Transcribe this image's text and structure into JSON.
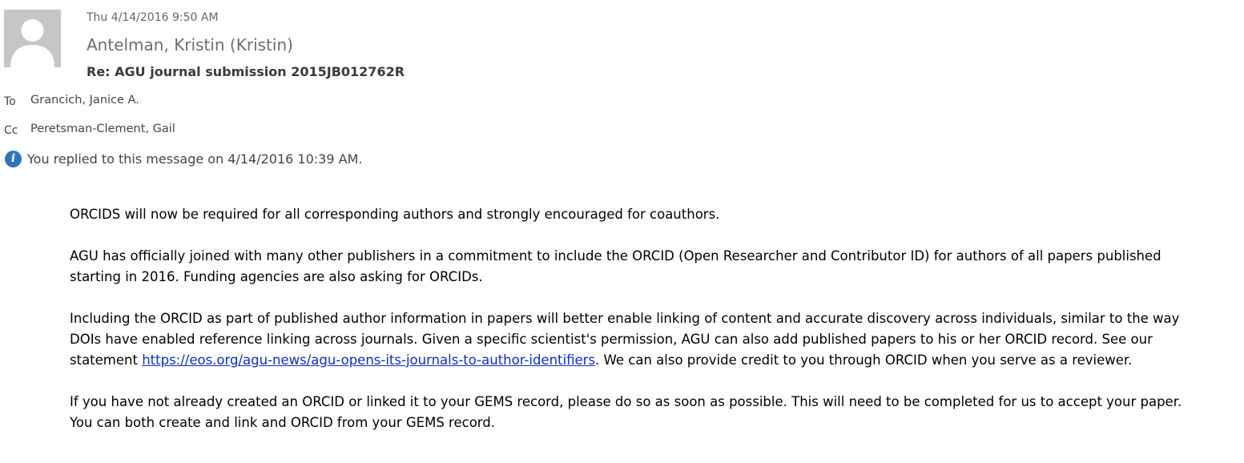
{
  "message": {
    "date": "Thu 4/14/2016 9:50 AM",
    "sender": "Antelman, Kristin (Kristin)",
    "subject": "Re: AGU journal submission 2015JB012762R",
    "to_label": "To",
    "to": "Grancich, Janice A.",
    "cc_label": "Cc",
    "cc": "Peretsman-Clement, Gail",
    "info_icon": "info-icon",
    "info_text": "You replied to this message on 4/14/2016 10:39 AM."
  },
  "body": {
    "p1": "ORCIDS will now be required for all corresponding authors and strongly encouraged for coauthors.",
    "p2": "AGU has officially joined with many other publishers in a commitment to include the ORCID (Open Researcher and Contributor ID) for authors of all papers published starting in 2016. Funding agencies are also asking for ORCIDs.",
    "p3_before": "Including the ORCID as part of published author information in papers will better enable linking of content and accurate discovery across individuals, similar to the way DOIs have enabled reference linking across journals. Given a specific scientist's permission, AGU can also add published papers to his or her ORCID record. See our statement ",
    "p3_link": "https://eos.org/agu-news/agu-opens-its-journals-to-author-identifiers",
    "p3_after": ". We can also provide credit to you through ORCID when you serve as a reviewer.",
    "p4": "If you have not already created an ORCID or linked it to your GEMS record, please do so as soon as possible. This will need to be completed for us to accept your paper. You can both create and link and ORCID from your GEMS record."
  },
  "colors": {
    "avatar_bg": "#c6c6c6",
    "info_icon": "#2e73c4",
    "link": "#0b2bd6"
  }
}
